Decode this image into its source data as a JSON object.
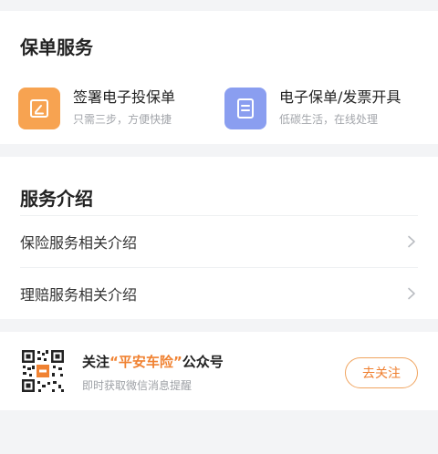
{
  "policy_services": {
    "title": "保单服务",
    "items": [
      {
        "title": "签署电子投保单",
        "subtitle": "只需三步，方便快捷",
        "icon": "edit-icon",
        "color": "#f7a351"
      },
      {
        "title": "电子保单/发票开具",
        "subtitle": "低碳生活，在线处理",
        "icon": "document-icon",
        "color": "#8a9ef0"
      }
    ]
  },
  "service_intro": {
    "title": "服务介绍",
    "items": [
      {
        "label": "保险服务相关介绍"
      },
      {
        "label": "理赔服务相关介绍"
      }
    ]
  },
  "follow": {
    "title_prefix": "关注",
    "brand": "“平安车险”",
    "title_suffix": "公众号",
    "subtitle": "即时获取微信消息提醒",
    "button_label": "去关注",
    "accent": "#ef7f2f"
  }
}
